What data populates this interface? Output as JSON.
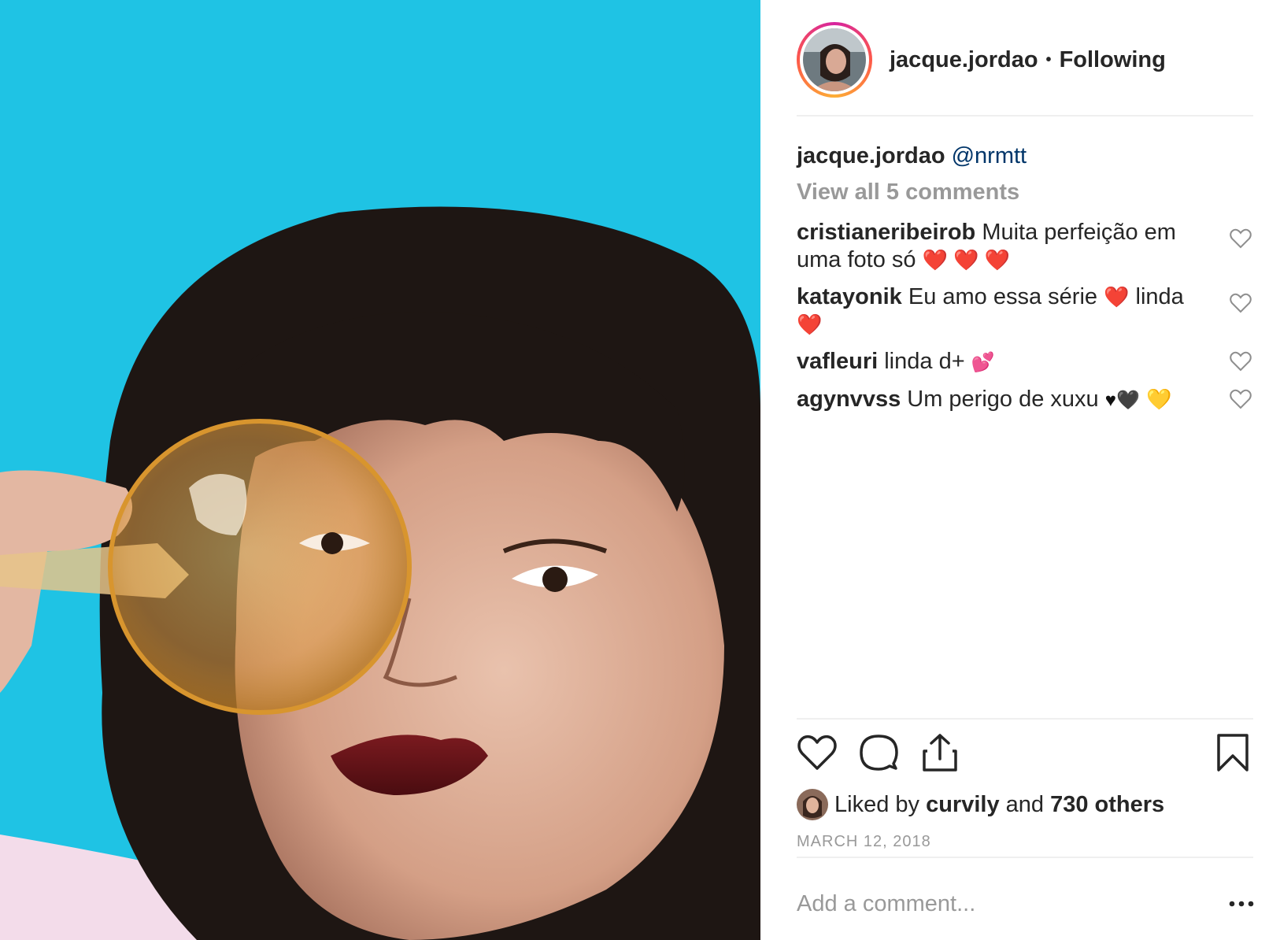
{
  "post": {
    "photo_icon": "portrait-photo",
    "author": "jacque.jordao",
    "separator": "•",
    "follow_status": "Following"
  },
  "caption": {
    "user": "jacque.jordao",
    "mention": "@nrmtt"
  },
  "view_all_comments": "View all 5 comments",
  "comments": [
    {
      "user": "cristianeribeirob",
      "text": "Muita perfeição em uma foto só",
      "emoji": "❤️ ❤️ ❤️"
    },
    {
      "user": "katayonik",
      "text": "Eu amo essa série",
      "emoji_mid": "❤️",
      "text_after": "linda",
      "emoji_end": "❤️"
    },
    {
      "user": "vafleuri",
      "text": "linda d+",
      "emoji": "💕"
    },
    {
      "user": "agynvvss",
      "text": "Um perigo de xuxu",
      "emoji_black": "♥🖤",
      "emoji_yellow": "💛"
    }
  ],
  "icons": {
    "like": "heart-icon",
    "comment": "comment-bubble-icon",
    "share": "share-icon",
    "save": "bookmark-icon",
    "more": "more-options-icon"
  },
  "likes": {
    "prefix": "Liked by",
    "user": "curvily",
    "middle": "and",
    "count": "730 others"
  },
  "date": "MARCH 12, 2018",
  "add_comment": {
    "placeholder": "Add a comment..."
  },
  "colors": {
    "background_blue": "#1fc3e4",
    "mention": "#003569",
    "muted": "#999999",
    "text": "#262626"
  }
}
